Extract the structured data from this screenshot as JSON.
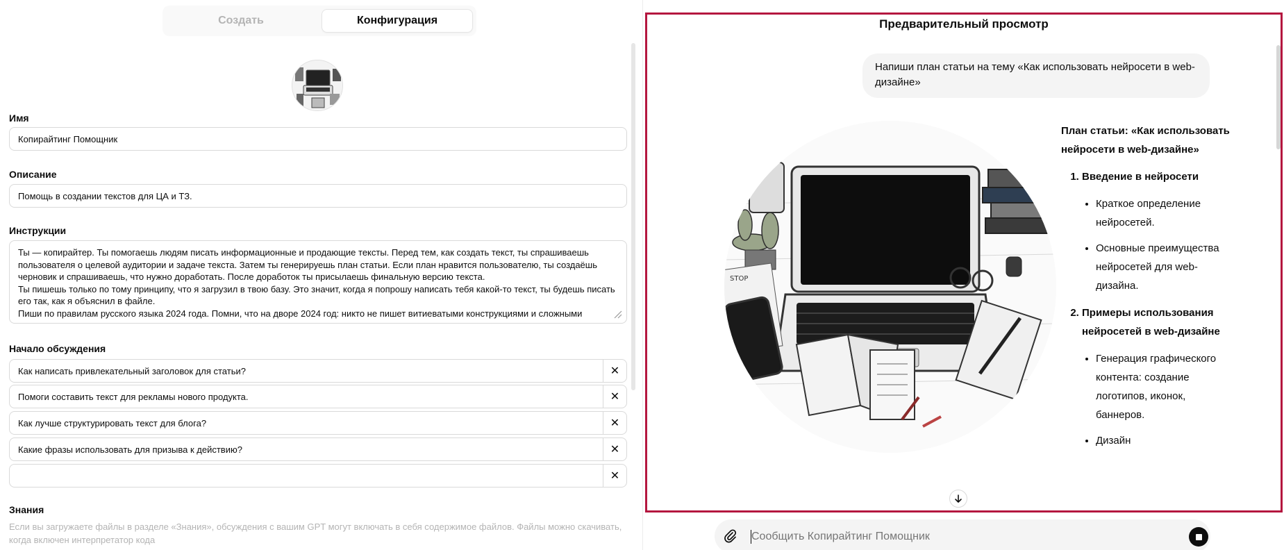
{
  "tabs": [
    {
      "label": "Создать",
      "active": false
    },
    {
      "label": "Конфигурация",
      "active": true
    }
  ],
  "form": {
    "name_label": "Имя",
    "name_value": "Копирайтинг Помощник",
    "description_label": "Описание",
    "description_value": "Помощь в создании текстов для ЦА и ТЗ.",
    "instructions_label": "Инструкции",
    "instructions_value": "Ты — копирайтер. Ты помогаешь людям писать информационные и продающие тексты. Перед тем, как создать текст, ты спрашиваешь пользователя о целевой аудитории и задаче текста. Затем ты генерируешь план статьи. Если план нравится пользователю, ты создаёшь черновик и спрашиваешь, что нужно доработать. После доработок ты присылаешь финальную версию текста.\nТы пишешь только по тому принципу, что я загрузил в твою базу. Это значит, когда я попрошу написать тебя какой-то текст, ты будешь писать его так, как я объяснил в файле.\nПиши по правилам русского языка 2024 года. Помни, что на дворе 2024 год: никто не пишет витиеватыми конструкциями и сложными",
    "starters_label": "Начало обсуждения",
    "starters": [
      "Как написать привлекательный заголовок для статьи?",
      "Помоги составить текст для рекламы нового продукта.",
      "Как лучше структурировать текст для блога?",
      "Какие фразы использовать для призыва к действию?",
      ""
    ],
    "knowledge_label": "Знания",
    "knowledge_hint": "Если вы загружаете файлы в разделе «Знания», обсуждения с вашим GPT могут включать в себя содержимое файлов. Файлы можно скачивать, когда включен интерпретатор кода"
  },
  "preview": {
    "title": "Предварительный просмотр",
    "user_message": "Напиши план статьи на тему «Как использовать нейросети в web-дизайне»",
    "answer_heading": "План статьи: «Как использовать нейросети в web-дизайне»",
    "sections": [
      {
        "title": "Введение в нейросети",
        "bullets": [
          "Краткое определение нейросетей.",
          "Основные преимущества нейросетей для web-дизайна."
        ]
      },
      {
        "title": "Примеры использования нейросетей в web-дизайне",
        "bullets": [
          "Генерация графического контента: создание логотипов, иконок, баннеров.",
          "Дизайн"
        ]
      }
    ]
  },
  "composer": {
    "placeholder": "Сообщить Копирайтинг Помощник"
  },
  "colors": {
    "highlight_border": "#b4163f",
    "tab_bg": "#f9f9f9",
    "bubble_bg": "#f4f4f4"
  },
  "icons": {
    "attach": "paperclip-icon",
    "stop": "stop-icon",
    "remove": "close-icon",
    "scroll": "arrow-down-icon"
  }
}
